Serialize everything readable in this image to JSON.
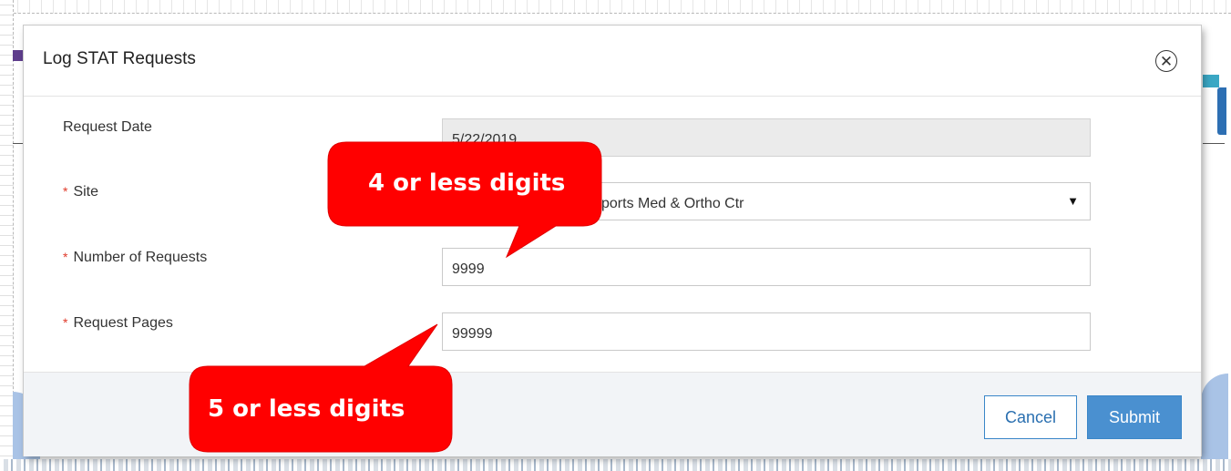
{
  "dialog": {
    "title": "Log STAT Requests",
    "close_icon": "close-circle-icon"
  },
  "form": {
    "request_date": {
      "label": "Request Date",
      "value": "5/22/2019"
    },
    "site": {
      "label": "Site",
      "required_mark": "*",
      "value": "Sports Med & Ortho Ctr",
      "visible_value": "ports Med & Ortho Ctr",
      "arrow": "▼"
    },
    "number_of_requests": {
      "label": "Number of Requests",
      "required_mark": "*",
      "value": "9999"
    },
    "request_pages": {
      "label": "Request Pages",
      "required_mark": "*",
      "value": "99999"
    }
  },
  "footer": {
    "cancel_label": "Cancel",
    "submit_label": "Submit"
  },
  "annotations": {
    "callout_top": "4 or less digits",
    "callout_bottom": "5 or less digits",
    "callout_color": "#ff0000"
  },
  "colors": {
    "accent": "#4a90d0",
    "required": "#e03a2a",
    "readonly_bg": "#ebebeb"
  }
}
